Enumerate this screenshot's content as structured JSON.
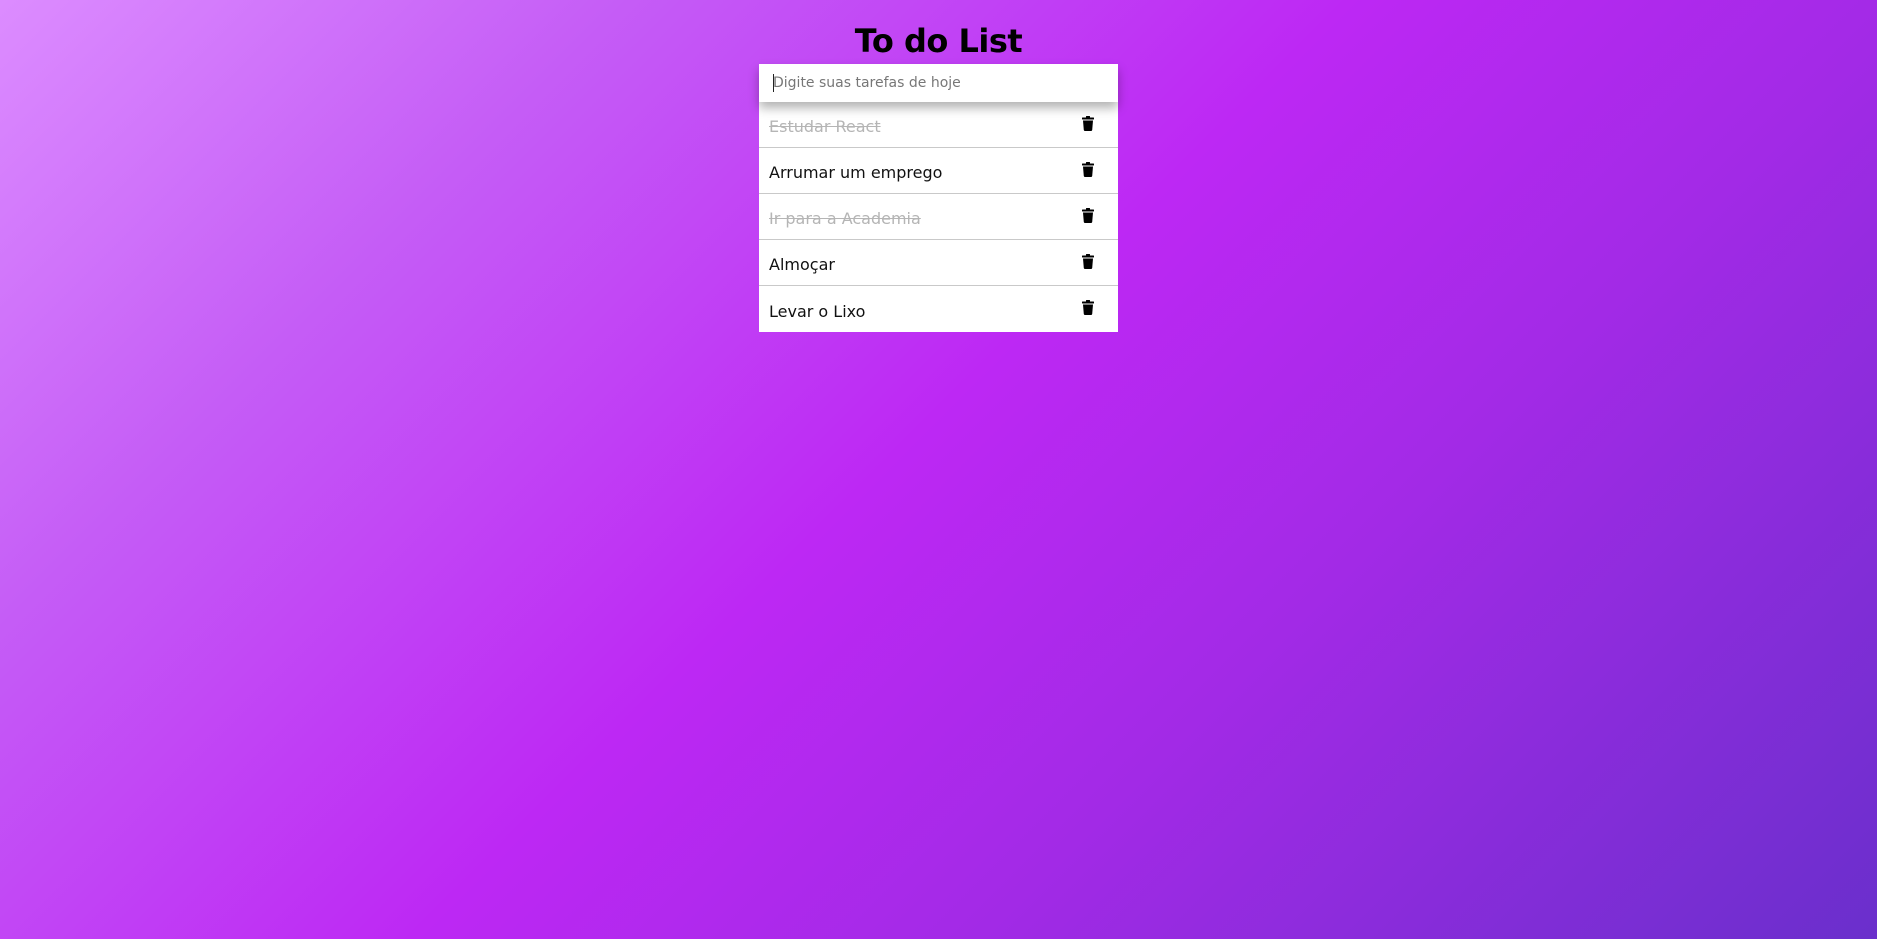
{
  "app": {
    "title": "To do List"
  },
  "input": {
    "placeholder": "Digite suas tarefas de hoje",
    "value": ""
  },
  "tasks": [
    {
      "label": "Estudar React",
      "completed": true,
      "delete_icon": "trash-icon"
    },
    {
      "label": "Arrumar um emprego",
      "completed": false,
      "delete_icon": "trash-icon"
    },
    {
      "label": "Ir para a Academia",
      "completed": true,
      "delete_icon": "trash-icon"
    },
    {
      "label": "Almoçar",
      "completed": false,
      "delete_icon": "trash-icon"
    },
    {
      "label": "Levar o Lixo",
      "completed": false,
      "delete_icon": "trash-icon"
    }
  ],
  "colors": {
    "background_start": "#dc8cff",
    "background_mid": "#bd28f4",
    "background_end": "#6a2fcc",
    "completed_text": "#b5b5b5"
  }
}
